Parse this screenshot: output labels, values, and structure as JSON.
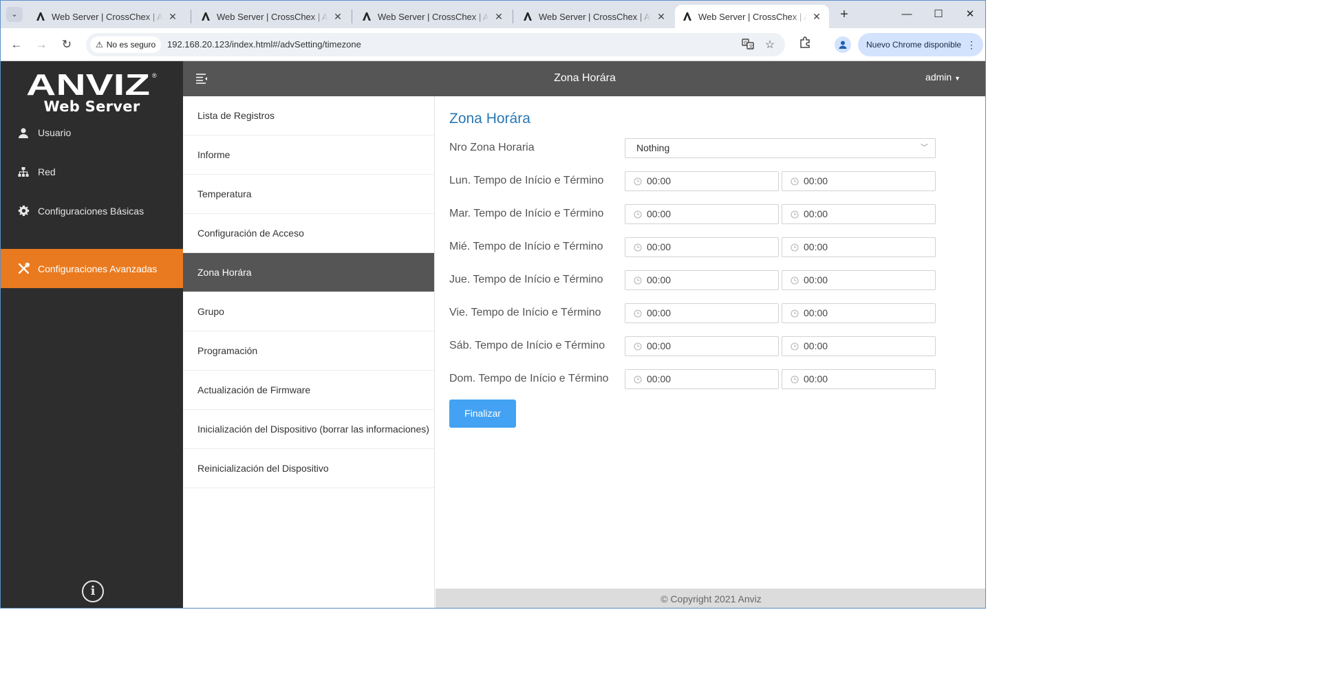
{
  "browser": {
    "tabs": [
      {
        "title": "Web Server | CrossChex | Anviz",
        "active": false
      },
      {
        "title": "Web Server | CrossChex | Anviz",
        "active": false
      },
      {
        "title": "Web Server | CrossChex | Anviz",
        "active": false
      },
      {
        "title": "Web Server | CrossChex | Anviz",
        "active": false
      },
      {
        "title": "Web Server | CrossChex | Anviz",
        "active": true
      }
    ],
    "security_label": "No es seguro",
    "url": "192.168.20.123/index.html#/advSetting/timezone",
    "update_label": "Nuevo Chrome disponible"
  },
  "app": {
    "brand": "ANVIZ",
    "brand_sub": "Web Server",
    "top_title": "Zona Horára",
    "user": "admin",
    "sidebar": [
      {
        "label": "Usuario",
        "icon": "user-icon"
      },
      {
        "label": "Red",
        "icon": "network-icon"
      },
      {
        "label": "Configuraciones Básicas",
        "icon": "gear-icon"
      },
      {
        "label": "Configuraciones Avanzadas",
        "icon": "tools-icon",
        "active": true
      }
    ],
    "submenu": [
      {
        "label": "Lista de Registros"
      },
      {
        "label": "Informe"
      },
      {
        "label": "Temperatura"
      },
      {
        "label": "Configuración de Acceso"
      },
      {
        "label": "Zona Horára",
        "active": true
      },
      {
        "label": "Grupo"
      },
      {
        "label": "Programación"
      },
      {
        "label": "Actualización de Firmware"
      },
      {
        "label": "Inicialización del Dispositivo (borrar las informaciones)"
      },
      {
        "label": "Reinicialización del Dispositivo"
      }
    ],
    "form": {
      "title": "Zona Horára",
      "zone_label": "Nro Zona Horaria",
      "zone_value": "Nothing",
      "days": [
        {
          "label": "Lun. Tempo de Início e Término",
          "start": "00:00",
          "end": "00:00"
        },
        {
          "label": "Mar. Tempo de Início e Término",
          "start": "00:00",
          "end": "00:00"
        },
        {
          "label": "Mié. Tempo de Início e Término",
          "start": "00:00",
          "end": "00:00"
        },
        {
          "label": "Jue. Tempo de Início e Término",
          "start": "00:00",
          "end": "00:00"
        },
        {
          "label": "Vie. Tempo de Início e Término",
          "start": "00:00",
          "end": "00:00"
        },
        {
          "label": "Sáb. Tempo de Início e Término",
          "start": "00:00",
          "end": "00:00"
        },
        {
          "label": "Dom. Tempo de Início e Término",
          "start": "00:00",
          "end": "00:00"
        }
      ],
      "submit": "Finalizar"
    },
    "footer": "© Copyright 2021 Anviz"
  },
  "colors": {
    "sidebar_bg": "#2d2d2d",
    "active_orange": "#ea7a1f",
    "topbar_bg": "#555555",
    "title_blue": "#2a77b3",
    "button_blue": "#43a2f3"
  }
}
